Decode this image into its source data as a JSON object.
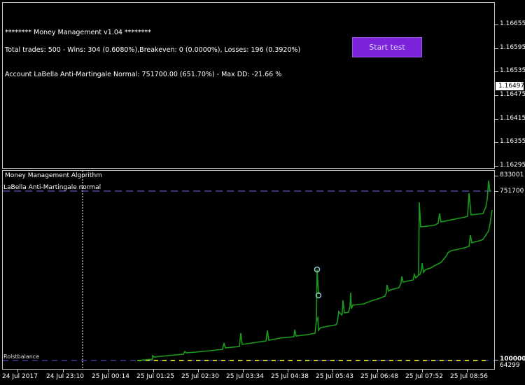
{
  "panel": {
    "header": "********    Money Management  v1.04 ********",
    "trades_summary": "Total trades: 500 - Wins: 304 (0.6080%),Breakeven: 0 (0.0000%), Losses: 196 (0.3920%)",
    "account_summary": "Account LaBella Anti-Martingale Normal: 751700.00 (651.70%) - Max DD: -21.66 %",
    "start_button": "Start test"
  },
  "price_axis": {
    "labels": [
      "1.16655",
      "1.16595",
      "1.16535",
      "1.16475",
      "1.16415",
      "1.16355",
      "1.16295"
    ],
    "current_price": "1.16497"
  },
  "indicator": {
    "title": "Money Management Algorithm",
    "series_label": "LaBella Anti-Martingale normal",
    "legend_overlap": "Rolstbalance",
    "axis_top": "833001",
    "axis_level": "751700",
    "axis_base": "100000",
    "axis_min": "64299"
  },
  "time_axis": {
    "labels": [
      "24 Jul 2017",
      "24 Jul 23:10",
      "25 Jul 00:14",
      "25 Jul 01:25",
      "25 Jul 02:30",
      "25 Jul 03:34",
      "25 Jul 04:38",
      "25 Jul 05:43",
      "25 Jul 06:48",
      "25 Jul 07:52",
      "25 Jul 08:56"
    ]
  },
  "colors": {
    "equity_line": "#1a9a1a",
    "level_line": "#7b68ee",
    "button": "#7a23d8",
    "base_line": "#c8c820"
  }
}
